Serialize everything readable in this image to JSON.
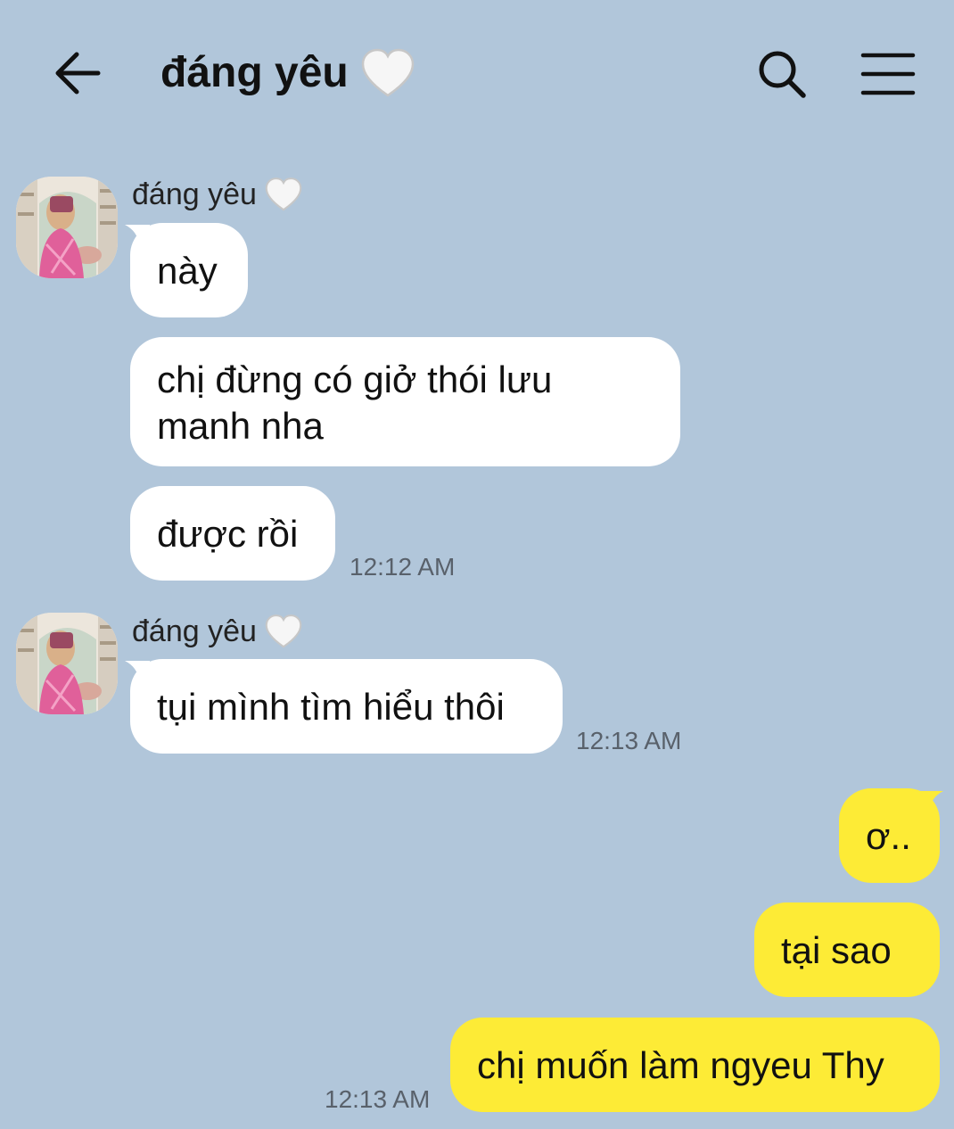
{
  "header": {
    "title": "đáng yêu",
    "icons": [
      "back-arrow-icon",
      "white-heart-icon",
      "search-icon",
      "menu-icon"
    ]
  },
  "colors": {
    "background": "#b1c6da",
    "incoming_bubble": "#ffffff",
    "outgoing_bubble": "#fdeb36",
    "timestamp": "#59616b"
  },
  "messages": {
    "group1": {
      "sender": "đáng yêu",
      "bubbles": [
        "này",
        "chị đừng có giở thói lưu manh nha",
        "được rồi"
      ],
      "time": "12:12 AM"
    },
    "group2": {
      "sender": "đáng yêu",
      "bubbles": [
        "tụi mình tìm hiểu thôi"
      ],
      "time": "12:13 AM"
    },
    "group3": {
      "bubbles": [
        "ơ..",
        "tại sao",
        "chị muốn làm ngyeu Thy"
      ],
      "time": "12:13 AM"
    }
  }
}
